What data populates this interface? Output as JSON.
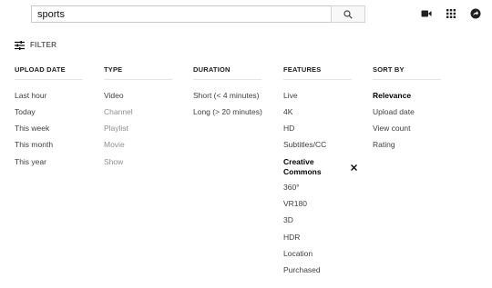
{
  "search": {
    "value": "sports"
  },
  "filter": {
    "label": "FILTER"
  },
  "groups": {
    "upload_date": {
      "header": "UPLOAD DATE",
      "options": [
        "Last hour",
        "Today",
        "This week",
        "This month",
        "This year"
      ]
    },
    "type": {
      "header": "TYPE",
      "options": [
        "Video",
        "Channel",
        "Playlist",
        "Movie",
        "Show"
      ]
    },
    "duration": {
      "header": "DURATION",
      "options": [
        "Short (< 4 minutes)",
        "Long (> 20 minutes)"
      ]
    },
    "features": {
      "header": "FEATURES",
      "options": [
        "Live",
        "4K",
        "HD",
        "Subtitles/CC",
        "Creative Commons",
        "360°",
        "VR180",
        "3D",
        "HDR",
        "Location",
        "Purchased"
      ]
    },
    "sort_by": {
      "header": "SORT BY",
      "options": [
        "Relevance",
        "Upload date",
        "View count",
        "Rating"
      ]
    }
  },
  "colors": {
    "disabled_text": "#909090",
    "selected_text": "#030303",
    "normal_text": "#3f3f3f"
  }
}
